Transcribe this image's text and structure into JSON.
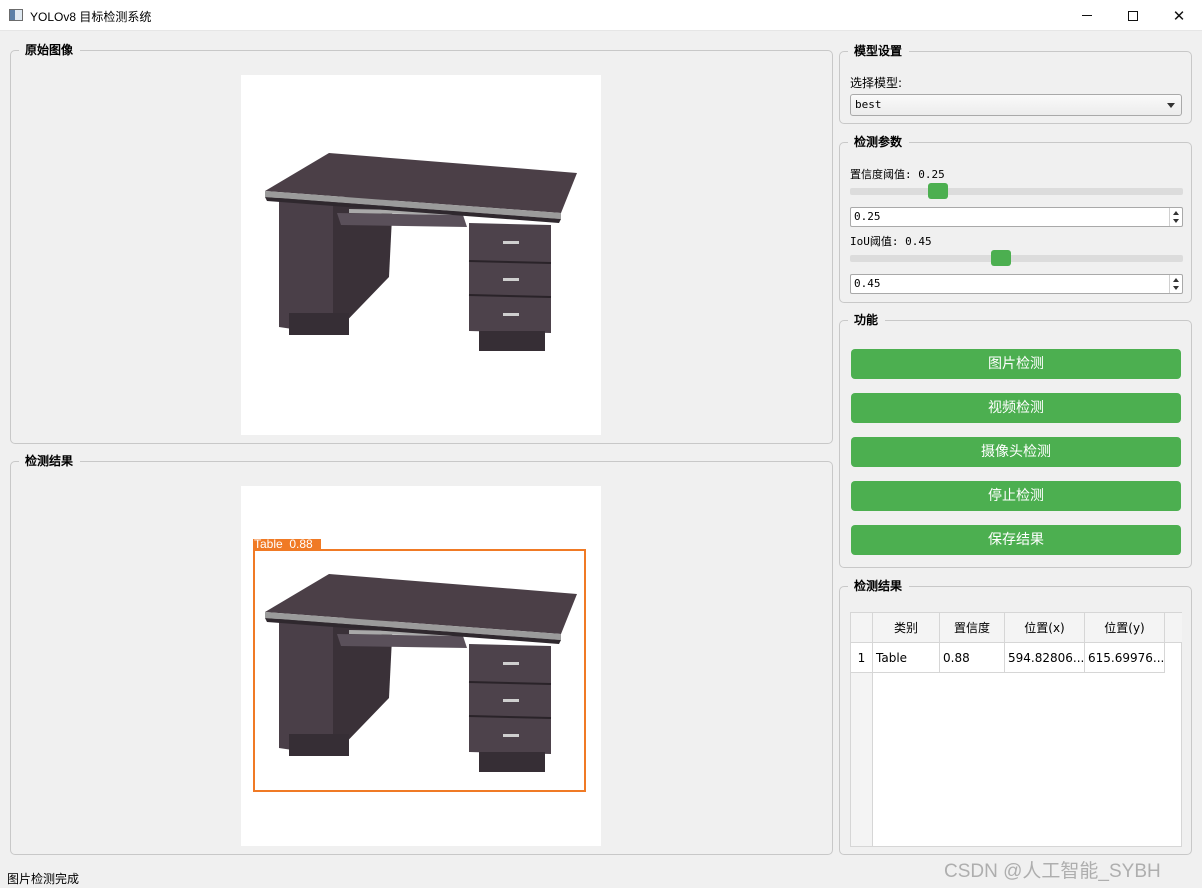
{
  "window": {
    "title": "YOLOv8 目标检测系统"
  },
  "original_panel": {
    "title": "原始图像"
  },
  "result_panel": {
    "title": "检测结果",
    "box_label": "Table  0.88",
    "box_color": "#f07a25"
  },
  "model_settings": {
    "title": "模型设置",
    "select_label": "选择模型:",
    "selected_model": "best"
  },
  "params": {
    "title": "检测参数",
    "conf_label": "置信度阈值: 0.25",
    "conf_value": "0.25",
    "conf_fraction": 0.25,
    "iou_label": "IoU阈值: 0.45",
    "iou_value": "0.45",
    "iou_fraction": 0.45
  },
  "functions": {
    "title": "功能",
    "buttons": [
      "图片检测",
      "视频检测",
      "摄像头检测",
      "停止检测",
      "保存结果"
    ],
    "accent": "#4caf50"
  },
  "results_table": {
    "title": "检测结果",
    "headers": [
      "类别",
      "置信度",
      "位置(x)",
      "位置(y)"
    ],
    "rows": [
      {
        "index": "1",
        "class": "Table",
        "confidence": "0.88",
        "x": "594.82806...",
        "y": "615.69976..."
      }
    ]
  },
  "status": {
    "text": "图片检测完成"
  },
  "watermark": "CSDN @人工智能_SYBH"
}
